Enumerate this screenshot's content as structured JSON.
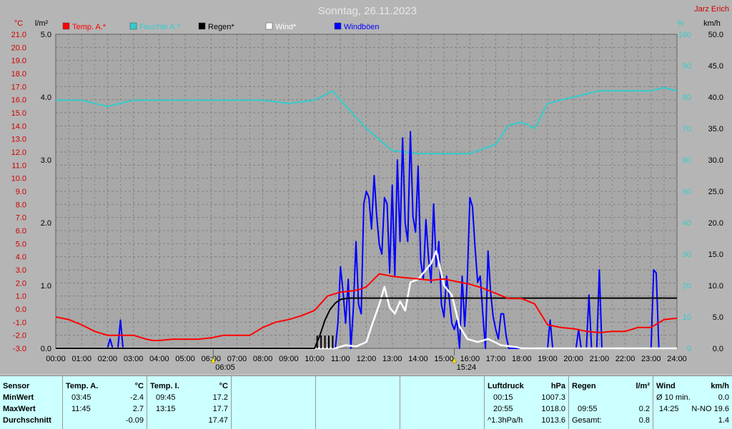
{
  "header": {
    "title": "Sonntag, 26.11.2023",
    "station": "Jarz Erich",
    "left_units": [
      "°C",
      "l/m²"
    ],
    "right_units": [
      "%",
      "km/h"
    ]
  },
  "legend": [
    {
      "label": "Temp. A.*",
      "color": "#ff0000"
    },
    {
      "label": "Feuchte A.*",
      "color": "#33cccc"
    },
    {
      "label": "Regen*",
      "color": "#000000"
    },
    {
      "label": "Wind*",
      "color": "#ffffff"
    },
    {
      "label": "Windböen",
      "color": "#0000ff"
    }
  ],
  "sun_markers": [
    "06:05",
    "15:24"
  ],
  "chart_data": {
    "type": "line",
    "title": "Sonntag, 26.11.2023",
    "x_ticks": [
      "00:00",
      "01:00",
      "02:00",
      "03:00",
      "04:00",
      "05:00",
      "06:00",
      "07:00",
      "08:00",
      "09:00",
      "10:00",
      "11:00",
      "12:00",
      "13:00",
      "14:00",
      "15:00",
      "16:00",
      "17:00",
      "18:00",
      "19:00",
      "20:00",
      "21:00",
      "22:00",
      "23:00",
      "24:00"
    ],
    "xlim_hours": [
      0,
      24
    ],
    "temp_axis": {
      "unit": "°C",
      "ylim": [
        -3.0,
        21.0
      ],
      "ticks": [
        "21.0",
        "20.0",
        "19.0",
        "18.0",
        "17.0",
        "16.0",
        "15.0",
        "14.0",
        "13.0",
        "12.0",
        "11.0",
        "10.0",
        "9.0",
        "8.0",
        "7.0",
        "6.0",
        "5.0",
        "4.0",
        "3.0",
        "2.0",
        "1.0",
        "0.0",
        "-1.0",
        "-2.0",
        "-3.0"
      ]
    },
    "rain_axis": {
      "unit": "l/m²",
      "ylim": [
        0,
        5.0
      ],
      "ticks": [
        "5.0",
        "4.0",
        "3.0",
        "2.0",
        "1.0",
        "0.0"
      ]
    },
    "humidity_axis": {
      "unit": "%",
      "ylim": [
        0,
        100
      ],
      "ticks": [
        "100",
        "90",
        "80",
        "70",
        "60",
        "50",
        "40",
        "30",
        "20",
        "10",
        "0"
      ]
    },
    "wind_axis": {
      "unit": "km/h",
      "ylim": [
        0,
        50.0
      ],
      "ticks": [
        "50.0",
        "45.0",
        "40.0",
        "35.0",
        "30.0",
        "25.0",
        "20.0",
        "15.0",
        "10.0",
        "5.0",
        "0.0"
      ]
    },
    "grid": true,
    "series": [
      {
        "name": "Temp. A.*",
        "color": "#ff0000",
        "axis": "temp",
        "x": [
          0,
          0.5,
          1,
          1.5,
          2,
          2.5,
          3,
          3.5,
          3.75,
          4,
          4.5,
          5,
          5.5,
          6,
          6.5,
          7,
          7.5,
          8,
          8.5,
          9,
          9.5,
          10,
          10.5,
          11,
          11.5,
          11.75,
          12,
          12.5,
          13,
          13.5,
          14,
          14.5,
          15,
          15.5,
          16,
          16.5,
          17,
          17.5,
          18,
          18.5,
          19,
          19.5,
          20,
          20.5,
          21,
          21.5,
          22,
          22.5,
          23,
          23.5,
          24
        ],
        "y": [
          -0.6,
          -0.8,
          -1.2,
          -1.7,
          -2.0,
          -2.0,
          -2.0,
          -2.3,
          -2.4,
          -2.4,
          -2.3,
          -2.3,
          -2.3,
          -2.2,
          -2.0,
          -2.0,
          -2.0,
          -1.4,
          -1.0,
          -0.8,
          -0.5,
          -0.1,
          1.0,
          1.3,
          1.4,
          1.5,
          1.7,
          2.7,
          2.5,
          2.4,
          2.3,
          2.2,
          2.3,
          2.1,
          1.9,
          1.6,
          1.2,
          0.8,
          0.8,
          0.4,
          -1.2,
          -1.4,
          -1.5,
          -1.7,
          -1.8,
          -1.7,
          -1.7,
          -1.4,
          -1.4,
          -0.8,
          -0.7
        ]
      },
      {
        "name": "Feuchte A.*",
        "color": "#33cccc",
        "axis": "humidity",
        "x": [
          0,
          1,
          2,
          3,
          4,
          5,
          6,
          7,
          8,
          9,
          10,
          10.7,
          11,
          12,
          13,
          14,
          15,
          16,
          17,
          17.5,
          18,
          18.5,
          19,
          20,
          21,
          22,
          23,
          23.5,
          24
        ],
        "y": [
          79,
          79,
          77,
          79,
          79,
          79,
          79,
          79,
          79,
          78,
          79,
          82,
          79,
          70,
          63,
          62,
          62,
          62,
          65,
          71,
          72,
          70,
          78,
          80,
          82,
          82,
          82,
          83,
          82
        ]
      },
      {
        "name": "Regen*",
        "color": "#000000",
        "axis": "rain",
        "x": [
          0,
          10.0,
          10.2,
          10.4,
          10.6,
          10.8,
          11.0,
          11.3,
          11.6,
          12,
          16,
          20,
          24
        ],
        "y": [
          0,
          0,
          0.2,
          0.45,
          0.62,
          0.72,
          0.78,
          0.8,
          0.8,
          0.8,
          0.8,
          0.8,
          0.8
        ]
      },
      {
        "name": "Wind*",
        "color": "#ffffff",
        "axis": "wind",
        "x": [
          0,
          10.8,
          11.2,
          11.6,
          12.0,
          12.2,
          12.5,
          12.7,
          12.9,
          13.1,
          13.3,
          13.5,
          13.7,
          14.0,
          14.3,
          14.5,
          14.7,
          15.0,
          15.3,
          15.6,
          15.9,
          16.3,
          16.7,
          17.2,
          17.8,
          18,
          24
        ],
        "y": [
          0,
          0,
          0.5,
          0.3,
          1.0,
          3.5,
          7.0,
          9.8,
          6.5,
          5.5,
          7.5,
          6.0,
          10.5,
          11.0,
          12.5,
          13.5,
          15.5,
          10.0,
          8.5,
          3.5,
          1.5,
          1.0,
          1.5,
          0.5,
          0.2,
          0,
          0
        ]
      },
      {
        "name": "Windböen",
        "color": "#0000ff",
        "axis": "wind",
        "x": [
          0,
          2.0,
          2.1,
          2.2,
          2.4,
          2.5,
          2.6,
          2.7,
          10.8,
          10.9,
          11.0,
          11.1,
          11.2,
          11.3,
          11.4,
          11.5,
          11.6,
          11.7,
          11.8,
          11.9,
          12.0,
          12.1,
          12.2,
          12.3,
          12.4,
          12.5,
          12.6,
          12.7,
          12.8,
          12.9,
          13.0,
          13.1,
          13.2,
          13.3,
          13.4,
          13.5,
          13.6,
          13.7,
          13.8,
          13.9,
          14.0,
          14.1,
          14.2,
          14.3,
          14.4,
          14.5,
          14.6,
          14.7,
          14.8,
          14.9,
          15.0,
          15.1,
          15.2,
          15.3,
          15.4,
          15.5,
          15.6,
          15.7,
          15.8,
          15.9,
          16.0,
          16.1,
          16.2,
          16.3,
          16.4,
          16.5,
          16.6,
          16.7,
          16.8,
          16.9,
          17.0,
          17.1,
          17.2,
          17.3,
          17.4,
          17.5,
          17.6,
          17.7,
          17.8,
          17.9,
          18.0,
          19.0,
          19.1,
          19.2,
          19.3,
          20.0,
          20.1,
          20.2,
          20.3,
          20.4,
          20.5,
          20.6,
          20.7,
          20.8,
          20.9,
          21.0,
          21.1,
          21.2,
          21.3,
          21.4,
          21.5,
          23.0,
          23.1,
          23.2,
          23.3,
          23.4,
          23.5,
          23.6,
          24
        ],
        "y": [
          0,
          0,
          1.5,
          0,
          0,
          4.5,
          0,
          0,
          0,
          4.0,
          13.0,
          9.0,
          4.0,
          11.0,
          0,
          6.5,
          17.0,
          7.0,
          5.5,
          23.0,
          25.0,
          24.0,
          19.0,
          27.5,
          21.0,
          16.5,
          15.0,
          24.0,
          23.0,
          12.0,
          26.0,
          11.5,
          30.0,
          17.0,
          33.5,
          20.0,
          17.0,
          34.5,
          21.0,
          18.5,
          29.0,
          14.0,
          11.0,
          20.5,
          14.5,
          10.5,
          23.0,
          13.0,
          17.0,
          7.0,
          5.0,
          11.5,
          8.0,
          4.0,
          3.0,
          4.5,
          0,
          11.5,
          3.5,
          11.0,
          24.0,
          22.5,
          16.0,
          10.5,
          11.5,
          5.5,
          0,
          15.5,
          9.0,
          5.0,
          3.0,
          1.5,
          5.5,
          5.5,
          2.0,
          0,
          0,
          0,
          0,
          0,
          0,
          0,
          4.5,
          0,
          0,
          0,
          0,
          3.0,
          0,
          0,
          0,
          8.5,
          0,
          0,
          0,
          12.5,
          0,
          0,
          0,
          0,
          0,
          0,
          12.5,
          12.0,
          0,
          0,
          0,
          0,
          0
        ]
      }
    ]
  },
  "table": {
    "row_labels": [
      "Sensor",
      "MinWert",
      "MaxWert",
      "Durchschnitt"
    ],
    "temp_a": {
      "title": "Temp. A.",
      "unit": "°C",
      "min_time": "03:45",
      "min_val": "-2.4",
      "max_time": "11:45",
      "max_val": "2.7",
      "avg": "-0.09"
    },
    "temp_i": {
      "title": "Temp. I.",
      "unit": "°C",
      "min_time": "09:45",
      "min_val": "17.2",
      "max_time": "13:15",
      "max_val": "17.7",
      "avg": "17.47"
    },
    "pressure": {
      "title": "Luftdruck",
      "unit": "hPa",
      "min_time": "00:15",
      "min_val": "1007.3",
      "max_time": "20:55",
      "max_val": "1018.0",
      "trend": "^1.3hPa/h",
      "avg": "1013.6"
    },
    "rain": {
      "title": "Regen",
      "unit": "l/m²",
      "max_time": "09:55",
      "max_val": "0.2",
      "total_label": "Gesamt:",
      "total": "0.8"
    },
    "wind": {
      "title": "Wind",
      "unit": "km/h",
      "min_label": "Ø 10 min.",
      "min_val": "0.0",
      "max_time": "14:25",
      "max_val": "N-NO 19.6",
      "avg": "1.4"
    }
  }
}
